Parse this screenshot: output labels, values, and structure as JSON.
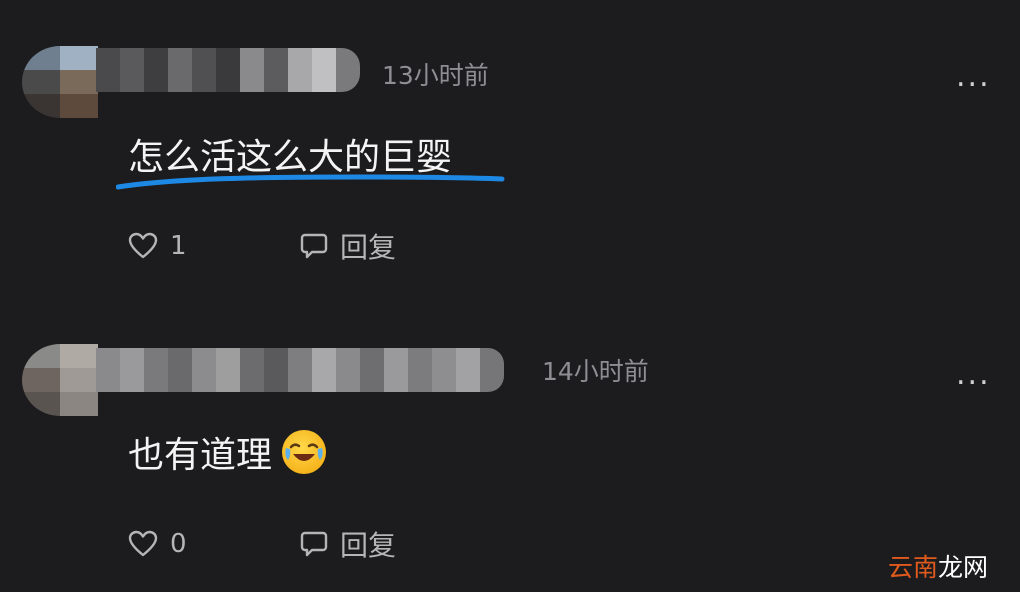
{
  "comments": [
    {
      "time": "13小时前",
      "text": "怎么活这么大的巨婴",
      "like_count": "1",
      "reply_label": "回复",
      "more_label": "..."
    },
    {
      "time": "14小时前",
      "text": "也有道理",
      "emoji": "laughing-crying-emoji",
      "like_count": "0",
      "reply_label": "回复",
      "more_label": "..."
    }
  ],
  "watermark": {
    "part1": "云南",
    "part2": "龙网"
  },
  "colors": {
    "background": "#1c1c1e",
    "highlight_underline": "#1e88e5",
    "watermark_accent": "#e05a1e"
  }
}
